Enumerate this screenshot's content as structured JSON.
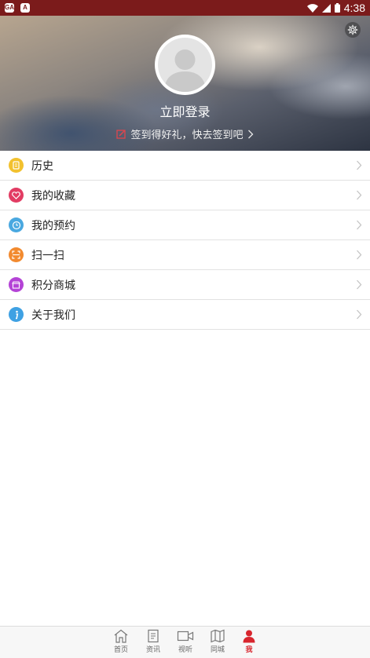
{
  "status_bar": {
    "time": "4:38",
    "left_icons": [
      "app-notification-icon",
      "a-notification-icon"
    ],
    "right_icons": [
      "wifi-icon",
      "signal-icon",
      "battery-icon"
    ]
  },
  "header": {
    "login_text": "立即登录",
    "checkin_text": "签到得好礼，快去签到吧",
    "icons": {
      "settings": "gear-icon",
      "checkin": "edit-icon"
    }
  },
  "menu": {
    "items": [
      {
        "label": "历史",
        "icon": "history-icon",
        "color": "#f2c12e"
      },
      {
        "label": "我的收藏",
        "icon": "heart-icon",
        "color": "#e23c63"
      },
      {
        "label": "我的预约",
        "icon": "clock-icon",
        "color": "#4aa8e0"
      },
      {
        "label": "扫一扫",
        "icon": "scan-icon",
        "color": "#f28a2f"
      },
      {
        "label": "积分商城",
        "icon": "store-icon",
        "color": "#b443d6"
      },
      {
        "label": "关于我们",
        "icon": "info-icon",
        "color": "#3fa1e3"
      }
    ]
  },
  "bottom_nav": {
    "items": [
      {
        "label": "首页",
        "icon": "home-icon"
      },
      {
        "label": "资讯",
        "icon": "news-icon"
      },
      {
        "label": "视听",
        "icon": "video-icon"
      },
      {
        "label": "同城",
        "icon": "map-icon"
      },
      {
        "label": "我",
        "icon": "user-icon",
        "active": true
      }
    ]
  },
  "colors": {
    "status_bar": "#7b1b1b",
    "accent": "#d8262e"
  }
}
